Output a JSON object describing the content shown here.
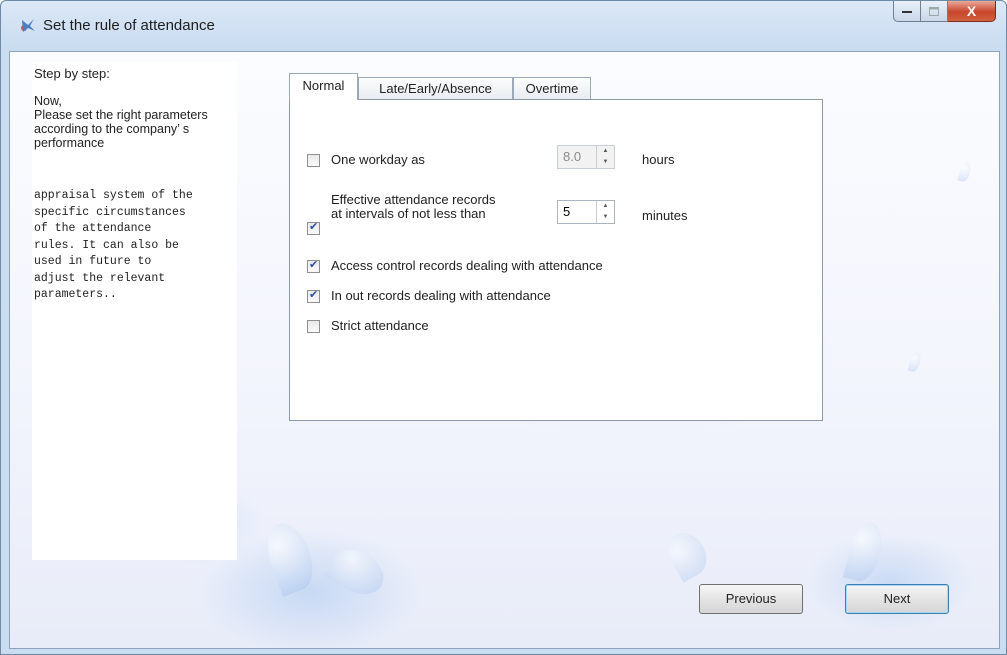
{
  "window": {
    "title": "Set the rule of attendance",
    "close_glyph": "X"
  },
  "steps": {
    "heading": "Step by step:",
    "intro": "Now,\nPlease set the right parameters according to the company’ s performance",
    "body": "appraisal system of the\nspecific circumstances\nof the attendance\nrules. It can also be\nused in future to\nadjust the relevant\nparameters.."
  },
  "tabs": [
    "Normal",
    "Late/Early/Absence",
    "Overtime"
  ],
  "normal": {
    "workday": {
      "label": "One workday as",
      "value": "8.0",
      "unit": "hours",
      "checked": false
    },
    "effective": {
      "label": "Effective attendance records at intervals of not less than",
      "value": "5",
      "unit": "minutes",
      "checked": true
    },
    "access_control": {
      "label": "Access control records dealing with attendance",
      "checked": true
    },
    "in_out": {
      "label": "In out records dealing with attendance",
      "checked": true
    },
    "strict": {
      "label": "Strict attendance",
      "checked": false
    }
  },
  "buttons": {
    "previous": "Previous",
    "next": "Next"
  }
}
